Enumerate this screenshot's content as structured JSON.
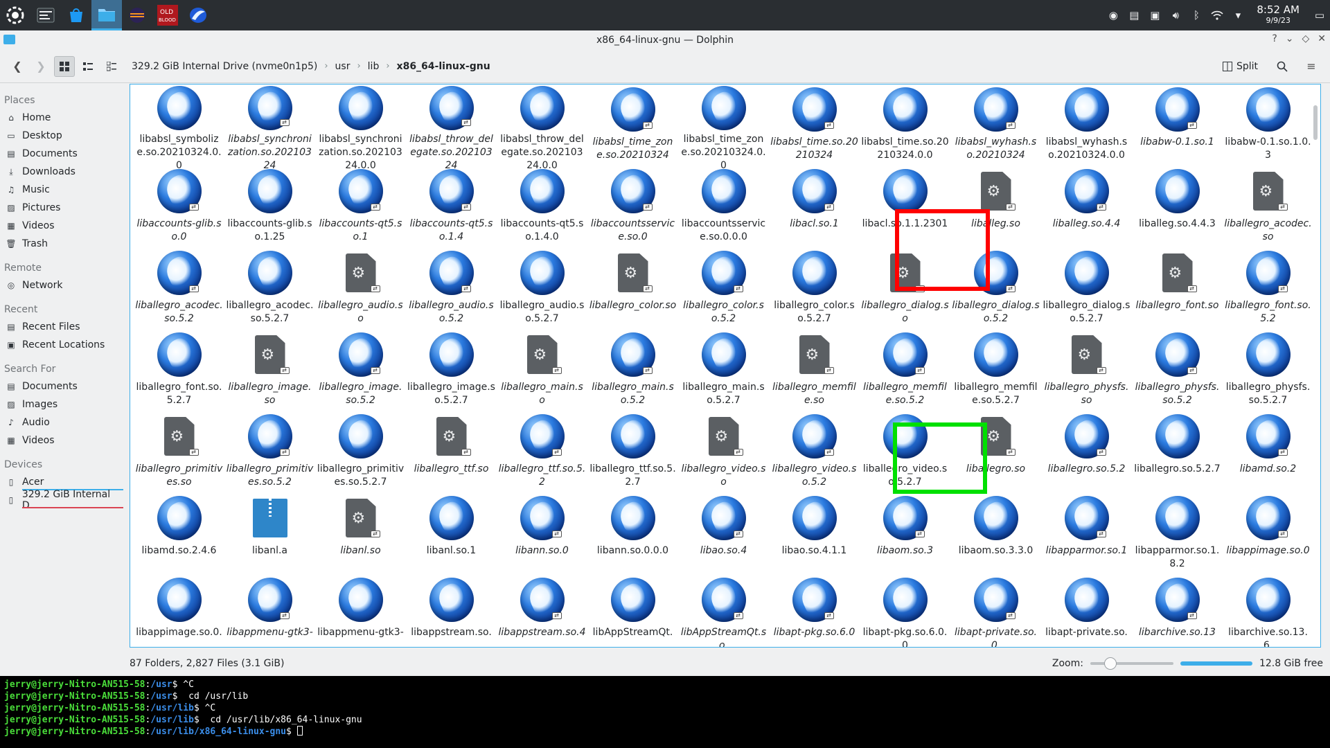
{
  "panel": {
    "launchers": [
      "app-menu-icon",
      "system-monitor-icon",
      "discover-store-icon",
      "dolphin-icon",
      "eclipse-icon",
      "old-blood-game-icon",
      "mandelbulber-icon"
    ],
    "clock_time": "8:52 AM",
    "clock_date": "9/9/23"
  },
  "window": {
    "title": "x86_64-linux-gnu — Dolphin",
    "buttons": [
      "?",
      "⌄",
      "◇",
      "✕"
    ]
  },
  "toolbar": {
    "crumbs": [
      "329.2 GiB Internal Drive (nvme0n1p5)",
      "usr",
      "lib",
      "x86_64-linux-gnu"
    ],
    "split_label": "Split"
  },
  "sidebar": {
    "places_title": "Places",
    "places": [
      {
        "label": "Home",
        "icon": "home-icon"
      },
      {
        "label": "Desktop",
        "icon": "desktop-icon"
      },
      {
        "label": "Documents",
        "icon": "documents-icon"
      },
      {
        "label": "Downloads",
        "icon": "downloads-icon"
      },
      {
        "label": "Music",
        "icon": "music-icon"
      },
      {
        "label": "Pictures",
        "icon": "pictures-icon"
      },
      {
        "label": "Videos",
        "icon": "videos-icon"
      },
      {
        "label": "Trash",
        "icon": "trash-icon"
      }
    ],
    "remote_title": "Remote",
    "remote": [
      {
        "label": "Network",
        "icon": "network-icon"
      }
    ],
    "recent_title": "Recent",
    "recent": [
      {
        "label": "Recent Files",
        "icon": "recent-files-icon"
      },
      {
        "label": "Recent Locations",
        "icon": "recent-locations-icon"
      }
    ],
    "search_title": "Search For",
    "search": [
      {
        "label": "Documents",
        "icon": "documents-icon"
      },
      {
        "label": "Images",
        "icon": "images-icon"
      },
      {
        "label": "Audio",
        "icon": "audio-icon"
      },
      {
        "label": "Videos",
        "icon": "videos-icon"
      }
    ],
    "devices_title": "Devices",
    "devices": [
      {
        "label": "Acer",
        "icon": "drive-icon",
        "bar_color": "#3daee9"
      },
      {
        "label": "329.2 GiB Internal D...",
        "icon": "drive-icon",
        "bar_color": "#da4453"
      }
    ]
  },
  "files": [
    {
      "name": "libabsl_symbolize.so.20210324.0.0",
      "type": "lib",
      "italic": false
    },
    {
      "name": "libabsl_synchronization.so.20210324",
      "type": "lib",
      "italic": true
    },
    {
      "name": "libabsl_synchronization.so.20210324.0.0",
      "type": "lib",
      "italic": false
    },
    {
      "name": "libabsl_throw_delegate.so.20210324",
      "type": "lib",
      "italic": true
    },
    {
      "name": "libabsl_throw_delegate.so.20210324.0.0",
      "type": "lib",
      "italic": false
    },
    {
      "name": "libabsl_time_zone.so.20210324",
      "type": "lib",
      "italic": true
    },
    {
      "name": "libabsl_time_zone.so.20210324.0.0",
      "type": "lib",
      "italic": false
    },
    {
      "name": "libabsl_time.so.20210324",
      "type": "lib",
      "italic": true
    },
    {
      "name": "libabsl_time.so.20210324.0.0",
      "type": "lib",
      "italic": false
    },
    {
      "name": "libabsl_wyhash.so.20210324",
      "type": "lib",
      "italic": true
    },
    {
      "name": "libabsl_wyhash.so.20210324.0.0",
      "type": "lib",
      "italic": false
    },
    {
      "name": "libabw-0.1.so.1",
      "type": "lib",
      "italic": true
    },
    {
      "name": "libabw-0.1.so.1.0.3",
      "type": "lib",
      "italic": false
    },
    {
      "name": "libaccounts-glib.so.0",
      "type": "lib",
      "italic": true
    },
    {
      "name": "libaccounts-glib.so.1.25",
      "type": "lib",
      "italic": false
    },
    {
      "name": "libaccounts-qt5.so.1",
      "type": "lib",
      "italic": true
    },
    {
      "name": "libaccounts-qt5.so.1.4",
      "type": "lib",
      "italic": true
    },
    {
      "name": "libaccounts-qt5.so.1.4.0",
      "type": "lib",
      "italic": false
    },
    {
      "name": "libaccountsservice.so.0",
      "type": "lib",
      "italic": true
    },
    {
      "name": "libaccountsservice.so.0.0.0",
      "type": "lib",
      "italic": false
    },
    {
      "name": "libacl.so.1",
      "type": "lib",
      "italic": true
    },
    {
      "name": "libacl.so.1.1.2301",
      "type": "lib",
      "italic": false
    },
    {
      "name": "liballeg.so",
      "type": "doc",
      "italic": true
    },
    {
      "name": "liballeg.so.4.4",
      "type": "lib",
      "italic": true
    },
    {
      "name": "liballeg.so.4.4.3",
      "type": "lib",
      "italic": false
    },
    {
      "name": "liballegro_acodec.so",
      "type": "doc",
      "italic": true
    },
    {
      "name": "liballegro_acodec.so.5.2",
      "type": "lib",
      "italic": true
    },
    {
      "name": "liballegro_acodec.so.5.2.7",
      "type": "lib",
      "italic": false
    },
    {
      "name": "liballegro_audio.so",
      "type": "doc",
      "italic": true
    },
    {
      "name": "liballegro_audio.so.5.2",
      "type": "lib",
      "italic": true
    },
    {
      "name": "liballegro_audio.so.5.2.7",
      "type": "lib",
      "italic": false
    },
    {
      "name": "liballegro_color.so",
      "type": "doc",
      "italic": true
    },
    {
      "name": "liballegro_color.so.5.2",
      "type": "lib",
      "italic": true
    },
    {
      "name": "liballegro_color.so.5.2.7",
      "type": "lib",
      "italic": false
    },
    {
      "name": "liballegro_dialog.so",
      "type": "doc",
      "italic": true
    },
    {
      "name": "liballegro_dialog.so.5.2",
      "type": "lib",
      "italic": true
    },
    {
      "name": "liballegro_dialog.so.5.2.7",
      "type": "lib",
      "italic": false
    },
    {
      "name": "liballegro_font.so",
      "type": "doc",
      "italic": true
    },
    {
      "name": "liballegro_font.so.5.2",
      "type": "lib",
      "italic": true
    },
    {
      "name": "liballegro_font.so.5.2.7",
      "type": "lib",
      "italic": false
    },
    {
      "name": "liballegro_image.so",
      "type": "doc",
      "italic": true
    },
    {
      "name": "liballegro_image.so.5.2",
      "type": "lib",
      "italic": true
    },
    {
      "name": "liballegro_image.so.5.2.7",
      "type": "lib",
      "italic": false
    },
    {
      "name": "liballegro_main.so",
      "type": "doc",
      "italic": true
    },
    {
      "name": "liballegro_main.so.5.2",
      "type": "lib",
      "italic": true
    },
    {
      "name": "liballegro_main.so.5.2.7",
      "type": "lib",
      "italic": false
    },
    {
      "name": "liballegro_memfile.so",
      "type": "doc",
      "italic": true
    },
    {
      "name": "liballegro_memfile.so.5.2",
      "type": "lib",
      "italic": true
    },
    {
      "name": "liballegro_memfile.so.5.2.7",
      "type": "lib",
      "italic": false
    },
    {
      "name": "liballegro_physfs.so",
      "type": "doc",
      "italic": true
    },
    {
      "name": "liballegro_physfs.so.5.2",
      "type": "lib",
      "italic": true
    },
    {
      "name": "liballegro_physfs.so.5.2.7",
      "type": "lib",
      "italic": false
    },
    {
      "name": "liballegro_primitives.so",
      "type": "doc",
      "italic": true
    },
    {
      "name": "liballegro_primitives.so.5.2",
      "type": "lib",
      "italic": true
    },
    {
      "name": "liballegro_primitives.so.5.2.7",
      "type": "lib",
      "italic": false
    },
    {
      "name": "liballegro_ttf.so",
      "type": "doc",
      "italic": true
    },
    {
      "name": "liballegro_ttf.so.5.2",
      "type": "lib",
      "italic": true
    },
    {
      "name": "liballegro_ttf.so.5.2.7",
      "type": "lib",
      "italic": false
    },
    {
      "name": "liballegro_video.so",
      "type": "doc",
      "italic": true
    },
    {
      "name": "liballegro_video.so.5.2",
      "type": "lib",
      "italic": true
    },
    {
      "name": "liballegro_video.so.5.2.7",
      "type": "lib",
      "italic": false
    },
    {
      "name": "liballegro.so",
      "type": "doc",
      "italic": true
    },
    {
      "name": "liballegro.so.5.2",
      "type": "lib",
      "italic": true
    },
    {
      "name": "liballegro.so.5.2.7",
      "type": "lib",
      "italic": false
    },
    {
      "name": "libamd.so.2",
      "type": "lib",
      "italic": true
    },
    {
      "name": "libamd.so.2.4.6",
      "type": "lib",
      "italic": false
    },
    {
      "name": "libanl.a",
      "type": "archive",
      "italic": false
    },
    {
      "name": "libanl.so",
      "type": "doc",
      "italic": true
    },
    {
      "name": "libanl.so.1",
      "type": "lib",
      "italic": false
    },
    {
      "name": "libann.so.0",
      "type": "lib",
      "italic": true
    },
    {
      "name": "libann.so.0.0.0",
      "type": "lib",
      "italic": false
    },
    {
      "name": "libao.so.4",
      "type": "lib",
      "italic": true
    },
    {
      "name": "libao.so.4.1.1",
      "type": "lib",
      "italic": false
    },
    {
      "name": "libaom.so.3",
      "type": "lib",
      "italic": true
    },
    {
      "name": "libaom.so.3.3.0",
      "type": "lib",
      "italic": false
    },
    {
      "name": "libapparmor.so.1",
      "type": "lib",
      "italic": true
    },
    {
      "name": "libapparmor.so.1.8.2",
      "type": "lib",
      "italic": false
    },
    {
      "name": "libappimage.so.0",
      "type": "lib",
      "italic": true
    },
    {
      "name": "libappimage.so.0.",
      "type": "lib",
      "italic": false
    },
    {
      "name": "libappmenu-gtk3-",
      "type": "lib",
      "italic": true
    },
    {
      "name": "libappmenu-gtk3-",
      "type": "lib",
      "italic": false
    },
    {
      "name": "libappstream.so.",
      "type": "lib",
      "italic": false
    },
    {
      "name": "libappstream.so.4",
      "type": "lib",
      "italic": true
    },
    {
      "name": "libAppStreamQt.",
      "type": "lib",
      "italic": false
    },
    {
      "name": "libAppStreamQt.so.",
      "type": "lib",
      "italic": true
    },
    {
      "name": "libapt-pkg.so.6.0",
      "type": "lib",
      "italic": true
    },
    {
      "name": "libapt-pkg.so.6.0.0",
      "type": "lib",
      "italic": false
    },
    {
      "name": "libapt-private.so.0.",
      "type": "lib",
      "italic": true
    },
    {
      "name": "libapt-private.so.",
      "type": "lib",
      "italic": false
    },
    {
      "name": "libarchive.so.13",
      "type": "lib",
      "italic": true
    },
    {
      "name": "libarchive.so.13.6.",
      "type": "lib",
      "italic": false
    }
  ],
  "status": {
    "count": "87 Folders, 2,827 Files (3.1 GiB)",
    "zoom_label": "Zoom:",
    "zoom_level": 0.2,
    "free": "12.8 GiB free"
  },
  "terminal": {
    "lines": [
      {
        "user": "jerry@jerry-Nitro-AN515-58",
        "path": "/usr",
        "cmd": " ^C"
      },
      {
        "user": "jerry@jerry-Nitro-AN515-58",
        "path": "/usr",
        "cmd": "  cd /usr/lib"
      },
      {
        "user": "jerry@jerry-Nitro-AN515-58",
        "path": "/usr/lib",
        "cmd": " ^C"
      },
      {
        "user": "jerry@jerry-Nitro-AN515-58",
        "path": "/usr/lib",
        "cmd": "  cd /usr/lib/x86_64-linux-gnu"
      },
      {
        "user": "jerry@jerry-Nitro-AN515-58",
        "path": "/usr/lib/x86_64-linux-gnu",
        "cmd": " "
      }
    ]
  }
}
